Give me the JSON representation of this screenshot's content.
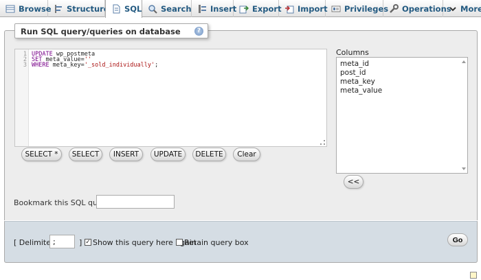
{
  "tabs": [
    {
      "label": "Browse",
      "icon": "browse-icon"
    },
    {
      "label": "Structure",
      "icon": "structure-icon"
    },
    {
      "label": "SQL",
      "icon": "sql-icon",
      "active": true
    },
    {
      "label": "Search",
      "icon": "search-icon"
    },
    {
      "label": "Insert",
      "icon": "insert-icon"
    },
    {
      "label": "Export",
      "icon": "export-icon"
    },
    {
      "label": "Import",
      "icon": "import-icon"
    },
    {
      "label": "Privileges",
      "icon": "privileges-icon"
    },
    {
      "label": "Operations",
      "icon": "operations-icon"
    },
    {
      "label": "More",
      "icon": "chevron-down-icon"
    }
  ],
  "query_box": {
    "legend": "Run SQL query/queries on database",
    "help_symbol": "?"
  },
  "editor": {
    "line_numbers": [
      "1",
      "2",
      "3"
    ],
    "lines": [
      {
        "keyword": "UPDATE",
        "text": " wp_postmeta",
        "string": ""
      },
      {
        "keyword": "SET",
        "text": " meta_value=",
        "string": "''"
      },
      {
        "keyword": "WHERE",
        "text": " meta_key=",
        "string": "'_sold_individually'",
        "tail": ";"
      }
    ]
  },
  "columns": {
    "label": "Columns",
    "items": [
      "meta_id",
      "post_id",
      "meta_key",
      "meta_value"
    ],
    "insert_button": "<<"
  },
  "buttons": {
    "select_star": "SELECT *",
    "select": "SELECT",
    "insert": "INSERT",
    "update": "UPDATE",
    "delete": "DELETE",
    "clear": "Clear"
  },
  "bookmark": {
    "label": "Bookmark this SQL query:",
    "value": ""
  },
  "footer": {
    "delimiter_open": "[ Delimiter",
    "delimiter_value": ";",
    "delimiter_close": "]",
    "show_query_label": "Show this query here again",
    "show_query_checked": true,
    "retain_label": "Retain query box",
    "retain_checked": false,
    "go_label": "Go"
  },
  "colors": {
    "tab_text": "#235a81",
    "sql_keyword": "#770088",
    "sql_string": "#aa1111"
  }
}
